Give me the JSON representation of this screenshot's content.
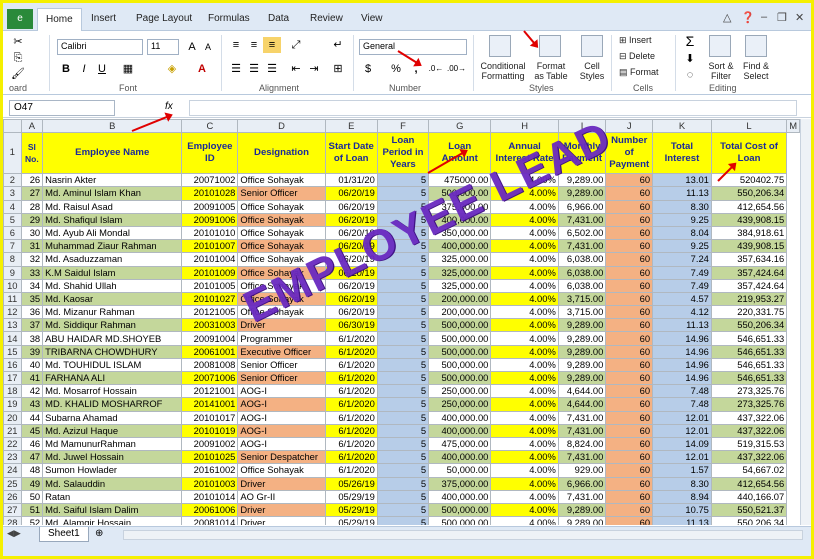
{
  "tabs": [
    "Home",
    "Insert",
    "Page Layout",
    "Formulas",
    "Data",
    "Review",
    "View"
  ],
  "file_label": "e",
  "font": {
    "name": "Calibri",
    "size": "11"
  },
  "number_format": "General",
  "ribbon_labels": {
    "clipboard": "oard",
    "font": "Font",
    "alignment": "Alignment",
    "number": "Number",
    "styles": "Styles",
    "cells": "Cells",
    "editing": "Editing",
    "conditional": "Conditional Formatting",
    "format_table": "Format as Table",
    "cell_styles": "Cell Styles",
    "insert": "Insert",
    "delete": "Delete",
    "format": "Format",
    "sort": "Sort & Filter",
    "find": "Find & Select",
    "bold": "B",
    "italic": "I",
    "underline": "U",
    "currency": "$",
    "percent": "%",
    "comma": ","
  },
  "name_box": "O47",
  "fx": "fx",
  "columns": [
    "A",
    "B",
    "C",
    "D",
    "E",
    "F",
    "G",
    "H",
    "I",
    "J",
    "K",
    "L",
    "M"
  ],
  "headers": [
    "Sl No.",
    "Employee Name",
    "Employee ID",
    "Designation",
    "Start Date of Loan",
    "Loan Period in Years",
    "Loan Amount",
    "Annual Interest Rate",
    "Monthly Payment",
    "Number of Payment",
    "Total Interest",
    "Total Cost of Loan"
  ],
  "header_row": "1",
  "rows": [
    {
      "r": "2",
      "sl": "26",
      "name": "Nasrin Akter",
      "id": "20071002",
      "des": "Office Sohayak",
      "date": "01/31/20",
      "period": "5",
      "amt": "475000.00",
      "rate": "4.00%",
      "pay": "9,289.00",
      "n": "60",
      "int": "13.01",
      "cost": "520402.75",
      "c": "plain"
    },
    {
      "r": "3",
      "sl": "27",
      "name": "Md. Aminul Islam Khan",
      "id": "20101028",
      "des": "Senior Officer",
      "date": "06/20/19",
      "period": "5",
      "amt": "500,000.00",
      "rate": "4.00%",
      "pay": "9,289.00",
      "n": "60",
      "int": "11.13",
      "cost": "550,206.34",
      "c": "green"
    },
    {
      "r": "4",
      "sl": "28",
      "name": "Md. Raisul Asad",
      "id": "20091005",
      "des": "Office Sohayak",
      "date": "06/20/19",
      "period": "5",
      "amt": "375,000.00",
      "rate": "4.00%",
      "pay": "6,966.00",
      "n": "60",
      "int": "8.30",
      "cost": "412,654.56",
      "c": "plain"
    },
    {
      "r": "5",
      "sl": "29",
      "name": "Md. Shafiqul Islam",
      "id": "20091006",
      "des": "Office Sohayak",
      "date": "06/20/19",
      "period": "5",
      "amt": "400,000.00",
      "rate": "4.00%",
      "pay": "7,431.00",
      "n": "60",
      "int": "9.25",
      "cost": "439,908.15",
      "c": "green"
    },
    {
      "r": "6",
      "sl": "30",
      "name": "Md. Ayub Ali Mondal",
      "id": "20101010",
      "des": "Office Sohayak",
      "date": "06/20/19",
      "period": "5",
      "amt": "350,000.00",
      "rate": "4.00%",
      "pay": "6,502.00",
      "n": "60",
      "int": "8.04",
      "cost": "384,918.61",
      "c": "plain"
    },
    {
      "r": "7",
      "sl": "31",
      "name": "Muhammad Ziaur Rahman",
      "id": "20101007",
      "des": "Office Sohayak",
      "date": "06/20/19",
      "period": "5",
      "amt": "400,000.00",
      "rate": "4.00%",
      "pay": "7,431.00",
      "n": "60",
      "int": "9.25",
      "cost": "439,908.15",
      "c": "green"
    },
    {
      "r": "8",
      "sl": "32",
      "name": "Md. Asaduzzaman",
      "id": "20101004",
      "des": "Office Sohayak",
      "date": "06/20/19",
      "period": "5",
      "amt": "325,000.00",
      "rate": "4.00%",
      "pay": "6,038.00",
      "n": "60",
      "int": "7.24",
      "cost": "357,634.16",
      "c": "plain"
    },
    {
      "r": "9",
      "sl": "33",
      "name": "K.M Saidul Islam",
      "id": "20101009",
      "des": "Office Sohayak",
      "date": "06/20/19",
      "period": "5",
      "amt": "325,000.00",
      "rate": "4.00%",
      "pay": "6,038.00",
      "n": "60",
      "int": "7.49",
      "cost": "357,424.64",
      "c": "green"
    },
    {
      "r": "10",
      "sl": "34",
      "name": "Md. Shahid Ullah",
      "id": "20101005",
      "des": "Office Sohayak",
      "date": "06/20/19",
      "period": "5",
      "amt": "325,000.00",
      "rate": "4.00%",
      "pay": "6,038.00",
      "n": "60",
      "int": "7.49",
      "cost": "357,424.64",
      "c": "plain"
    },
    {
      "r": "11",
      "sl": "35",
      "name": "Md. Kaosar",
      "id": "20101027",
      "des": "Office Sohayak",
      "date": "06/20/19",
      "period": "5",
      "amt": "200,000.00",
      "rate": "4.00%",
      "pay": "3,715.00",
      "n": "60",
      "int": "4.57",
      "cost": "219,953.27",
      "c": "green"
    },
    {
      "r": "12",
      "sl": "36",
      "name": "Md. Mizanur Rahman",
      "id": "20121005",
      "des": "Office Sohayak",
      "date": "06/20/19",
      "period": "5",
      "amt": "200,000.00",
      "rate": "4.00%",
      "pay": "3,715.00",
      "n": "60",
      "int": "4.12",
      "cost": "220,331.75",
      "c": "plain"
    },
    {
      "r": "13",
      "sl": "37",
      "name": "Md. Siddiqur Rahman",
      "id": "20031003",
      "des": "Driver",
      "date": "06/30/19",
      "period": "5",
      "amt": "500,000.00",
      "rate": "4.00%",
      "pay": "9,289.00",
      "n": "60",
      "int": "11.13",
      "cost": "550,206.34",
      "c": "green"
    },
    {
      "r": "14",
      "sl": "38",
      "name": "ABU HAIDAR MD.SHOYEB",
      "id": "20091004",
      "des": "Programmer",
      "date": "6/1/2020",
      "period": "5",
      "amt": "500,000.00",
      "rate": "4.00%",
      "pay": "9,289.00",
      "n": "60",
      "int": "14.96",
      "cost": "546,651.33",
      "c": "plain"
    },
    {
      "r": "15",
      "sl": "39",
      "name": "TRIBARNA CHOWDHURY",
      "id": "20061001",
      "des": "Executive Officer",
      "date": "6/1/2020",
      "period": "5",
      "amt": "500,000.00",
      "rate": "4.00%",
      "pay": "9,289.00",
      "n": "60",
      "int": "14.96",
      "cost": "546,651.33",
      "c": "green"
    },
    {
      "r": "16",
      "sl": "40",
      "name": "Md. TOUHIDUL ISLAM",
      "id": "20081008",
      "des": "Senior Officer",
      "date": "6/1/2020",
      "period": "5",
      "amt": "500,000.00",
      "rate": "4.00%",
      "pay": "9,289.00",
      "n": "60",
      "int": "14.96",
      "cost": "546,651.33",
      "c": "plain"
    },
    {
      "r": "17",
      "sl": "41",
      "name": "FARHANA ALI",
      "id": "20071006",
      "des": "Senior Officer",
      "date": "6/1/2020",
      "period": "5",
      "amt": "500,000.00",
      "rate": "4.00%",
      "pay": "9,289.00",
      "n": "60",
      "int": "14.96",
      "cost": "546,651.33",
      "c": "green"
    },
    {
      "r": "18",
      "sl": "42",
      "name": "Md. Mosarrof Hossain",
      "id": "20121001",
      "des": "AOG-I",
      "date": "6/1/2020",
      "period": "5",
      "amt": "250,000.00",
      "rate": "4.00%",
      "pay": "4,644.00",
      "n": "60",
      "int": "7.48",
      "cost": "273,325.76",
      "c": "plain"
    },
    {
      "r": "19",
      "sl": "43",
      "name": "MD. KHALID MOSHARROF",
      "id": "20141001",
      "des": "AOG-I",
      "date": "6/1/2020",
      "period": "5",
      "amt": "250,000.00",
      "rate": "4.00%",
      "pay": "4,644.00",
      "n": "60",
      "int": "7.48",
      "cost": "273,325.76",
      "c": "green"
    },
    {
      "r": "20",
      "sl": "44",
      "name": "Subarna Ahamad",
      "id": "20101017",
      "des": "AOG-I",
      "date": "6/1/2020",
      "period": "5",
      "amt": "400,000.00",
      "rate": "4.00%",
      "pay": "7,431.00",
      "n": "60",
      "int": "12.01",
      "cost": "437,322.06",
      "c": "plain"
    },
    {
      "r": "21",
      "sl": "45",
      "name": "Md. Azizul Haque",
      "id": "20101019",
      "des": "AOG-I",
      "date": "6/1/2020",
      "period": "5",
      "amt": "400,000.00",
      "rate": "4.00%",
      "pay": "7,431.00",
      "n": "60",
      "int": "12.01",
      "cost": "437,322.06",
      "c": "green"
    },
    {
      "r": "22",
      "sl": "46",
      "name": "Md MamunurRahman",
      "id": "20091002",
      "des": "AOG-I",
      "date": "6/1/2020",
      "period": "5",
      "amt": "475,000.00",
      "rate": "4.00%",
      "pay": "8,824.00",
      "n": "60",
      "int": "14.09",
      "cost": "519,315.53",
      "c": "plain"
    },
    {
      "r": "23",
      "sl": "47",
      "name": "Md. Juwel Hossain",
      "id": "20101025",
      "des": "Senior Despatcher",
      "date": "6/1/2020",
      "period": "5",
      "amt": "400,000.00",
      "rate": "4.00%",
      "pay": "7,431.00",
      "n": "60",
      "int": "12.01",
      "cost": "437,322.06",
      "c": "green"
    },
    {
      "r": "24",
      "sl": "48",
      "name": "Sumon Howlader",
      "id": "20161002",
      "des": "Office Sohayak",
      "date": "6/1/2020",
      "period": "5",
      "amt": "50,000.00",
      "rate": "4.00%",
      "pay": "929.00",
      "n": "60",
      "int": "1.57",
      "cost": "54,667.02",
      "c": "plain"
    },
    {
      "r": "25",
      "sl": "49",
      "name": "Md. Salauddin",
      "id": "20101003",
      "des": "Driver",
      "date": "05/26/19",
      "period": "5",
      "amt": "375,000.00",
      "rate": "4.00%",
      "pay": "6,966.00",
      "n": "60",
      "int": "8.30",
      "cost": "412,654.56",
      "c": "green"
    },
    {
      "r": "26",
      "sl": "50",
      "name": "Ratan",
      "id": "20101014",
      "des": "AO Gr-II",
      "date": "05/29/19",
      "period": "5",
      "amt": "400,000.00",
      "rate": "4.00%",
      "pay": "7,431.00",
      "n": "60",
      "int": "8.94",
      "cost": "440,166.07",
      "c": "plain"
    },
    {
      "r": "27",
      "sl": "51",
      "name": "Md. Saiful Islam Dalim",
      "id": "20061006",
      "des": "Driver",
      "date": "05/29/19",
      "period": "5",
      "amt": "500,000.00",
      "rate": "4.00%",
      "pay": "9,289.00",
      "n": "60",
      "int": "10.75",
      "cost": "550,521.37",
      "c": "green"
    },
    {
      "r": "28",
      "sl": "52",
      "name": "Md. Alamgir Hossain",
      "id": "20081014",
      "des": "Driver",
      "date": "05/29/19",
      "period": "5",
      "amt": "500,000.00",
      "rate": "4.00%",
      "pay": "9,289.00",
      "n": "60",
      "int": "11.13",
      "cost": "550,206.34",
      "c": "plain"
    }
  ],
  "watermark": "EMPLOYEE LEAD",
  "sheet_tab": "Sheet1"
}
